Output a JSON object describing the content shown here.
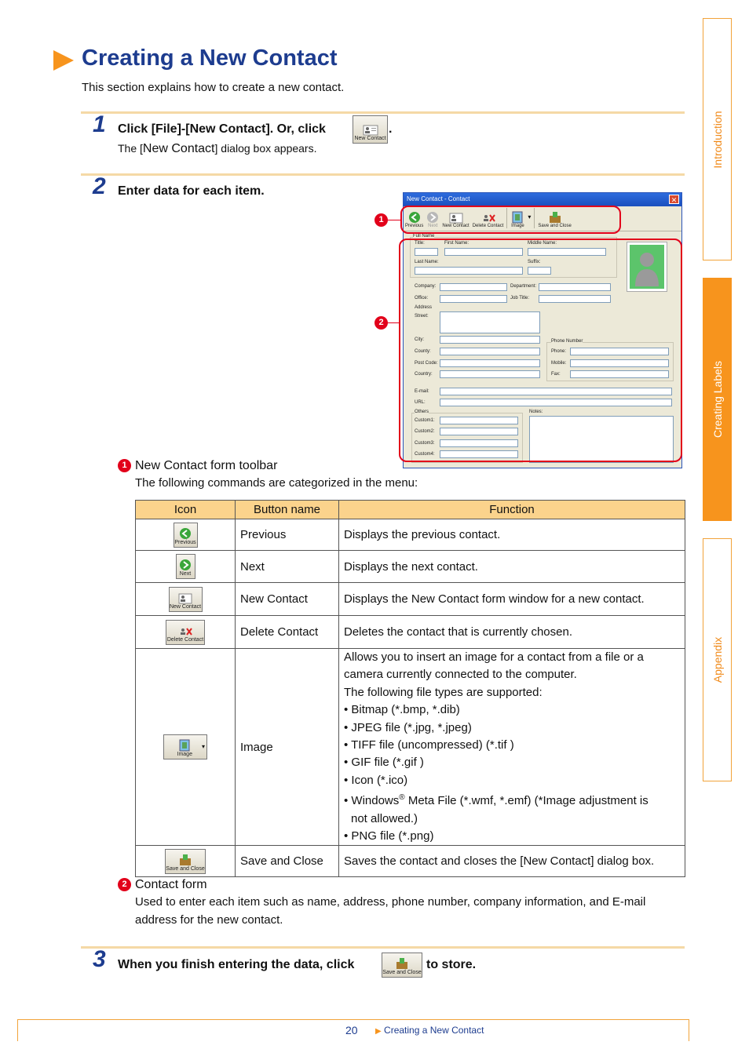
{
  "side_tabs": [
    "Introduction",
    "Creating Labels",
    "Appendix"
  ],
  "title": "Creating a New Contact",
  "intro": "This section explains how to create a new contact.",
  "step1": {
    "num": "1",
    "text": "Click [File]-[New Contact]. Or, click",
    "after": ".",
    "icon_label": "New Contact",
    "sub_pre": "The [",
    "sub_name": "New Contact",
    "sub_post": "] dialog box appears."
  },
  "step2": {
    "num": "2",
    "text": "Enter data for each item."
  },
  "dialog": {
    "title": "New Contact - Contact",
    "close": "✕",
    "toolbar": [
      "Previous",
      "Next",
      "New Contact",
      "Delete Contact",
      "Image",
      "Save and Close"
    ],
    "groups": {
      "full_name": "Full Name",
      "address": "Address",
      "phone": "Phone Number",
      "others": "Others"
    },
    "fields": {
      "title": "Title:",
      "first": "First Name:",
      "middle": "Middle Name:",
      "last": "Last Name:",
      "suffix": "Suffix:",
      "company": "Company:",
      "department": "Department:",
      "office": "Office:",
      "job": "Job Title:",
      "street": "Street:",
      "city": "City:",
      "county": "County:",
      "post": "Post Code:",
      "country": "Country:",
      "phone": "Phone:",
      "mobile": "Mobile:",
      "fax": "Fax:",
      "email": "E-mail:",
      "url": "URL:",
      "custom1": "Custom1:",
      "custom2": "Custom2:",
      "custom3": "Custom3:",
      "custom4": "Custom4:",
      "notes": "Notes:"
    }
  },
  "callouts": [
    "1",
    "2"
  ],
  "toolbar_section": {
    "heading": "New Contact form toolbar",
    "sub": "The following commands are categorized in the menu:"
  },
  "table": {
    "headers": [
      "Icon",
      "Button name",
      "Function"
    ],
    "rows": [
      {
        "icon": "Previous",
        "name": "Previous",
        "function": "Displays the previous contact."
      },
      {
        "icon": "Next",
        "name": "Next",
        "function": "Displays the next contact."
      },
      {
        "icon": "New Contact",
        "name": "New Contact",
        "function": "Displays the New Contact form window for a new contact."
      },
      {
        "icon": "Delete Contact",
        "name": "Delete Contact",
        "function": "Deletes the contact that is currently chosen."
      },
      {
        "icon": "Image",
        "name": "Image",
        "function_lines": [
          "Allows you to insert an image for a contact from a file or a",
          "camera currently connected to the computer.",
          "The following file types are supported:",
          "• Bitmap (*.bmp, *.dib)",
          "• JPEG file (*.jpg, *.jpeg)",
          "• TIFF file (uncompressed) (*.tif )",
          "• GIF file (*.gif )",
          "• Icon (*.ico)",
          "• Windows",
          "not allowed.)",
          "• PNG file (*.png)"
        ],
        "windows_sup": "®",
        "windows_rest": " Meta File (*.wmf, *.emf) (*Image adjustment is"
      },
      {
        "icon": "Save and Close",
        "name": "Save and Close",
        "function": "Saves the contact and closes the [New Contact] dialog box."
      }
    ]
  },
  "contact_form": {
    "heading": "Contact form",
    "line1": "Used to enter each item such as name, address, phone number, company information, and E-mail",
    "line2": "address for the new contact."
  },
  "step3": {
    "num": "3",
    "text": "When you finish entering the data, click",
    "after": "to store.",
    "icon_label": "Save and Close"
  },
  "footer": {
    "page": "20",
    "link": "Creating a New Contact",
    "arrow": "▶"
  },
  "colors": {
    "accent": "#f7941d",
    "title_blue": "#1d3c8f",
    "callout_red": "#e2001a",
    "table_header": "#fbd38c"
  }
}
